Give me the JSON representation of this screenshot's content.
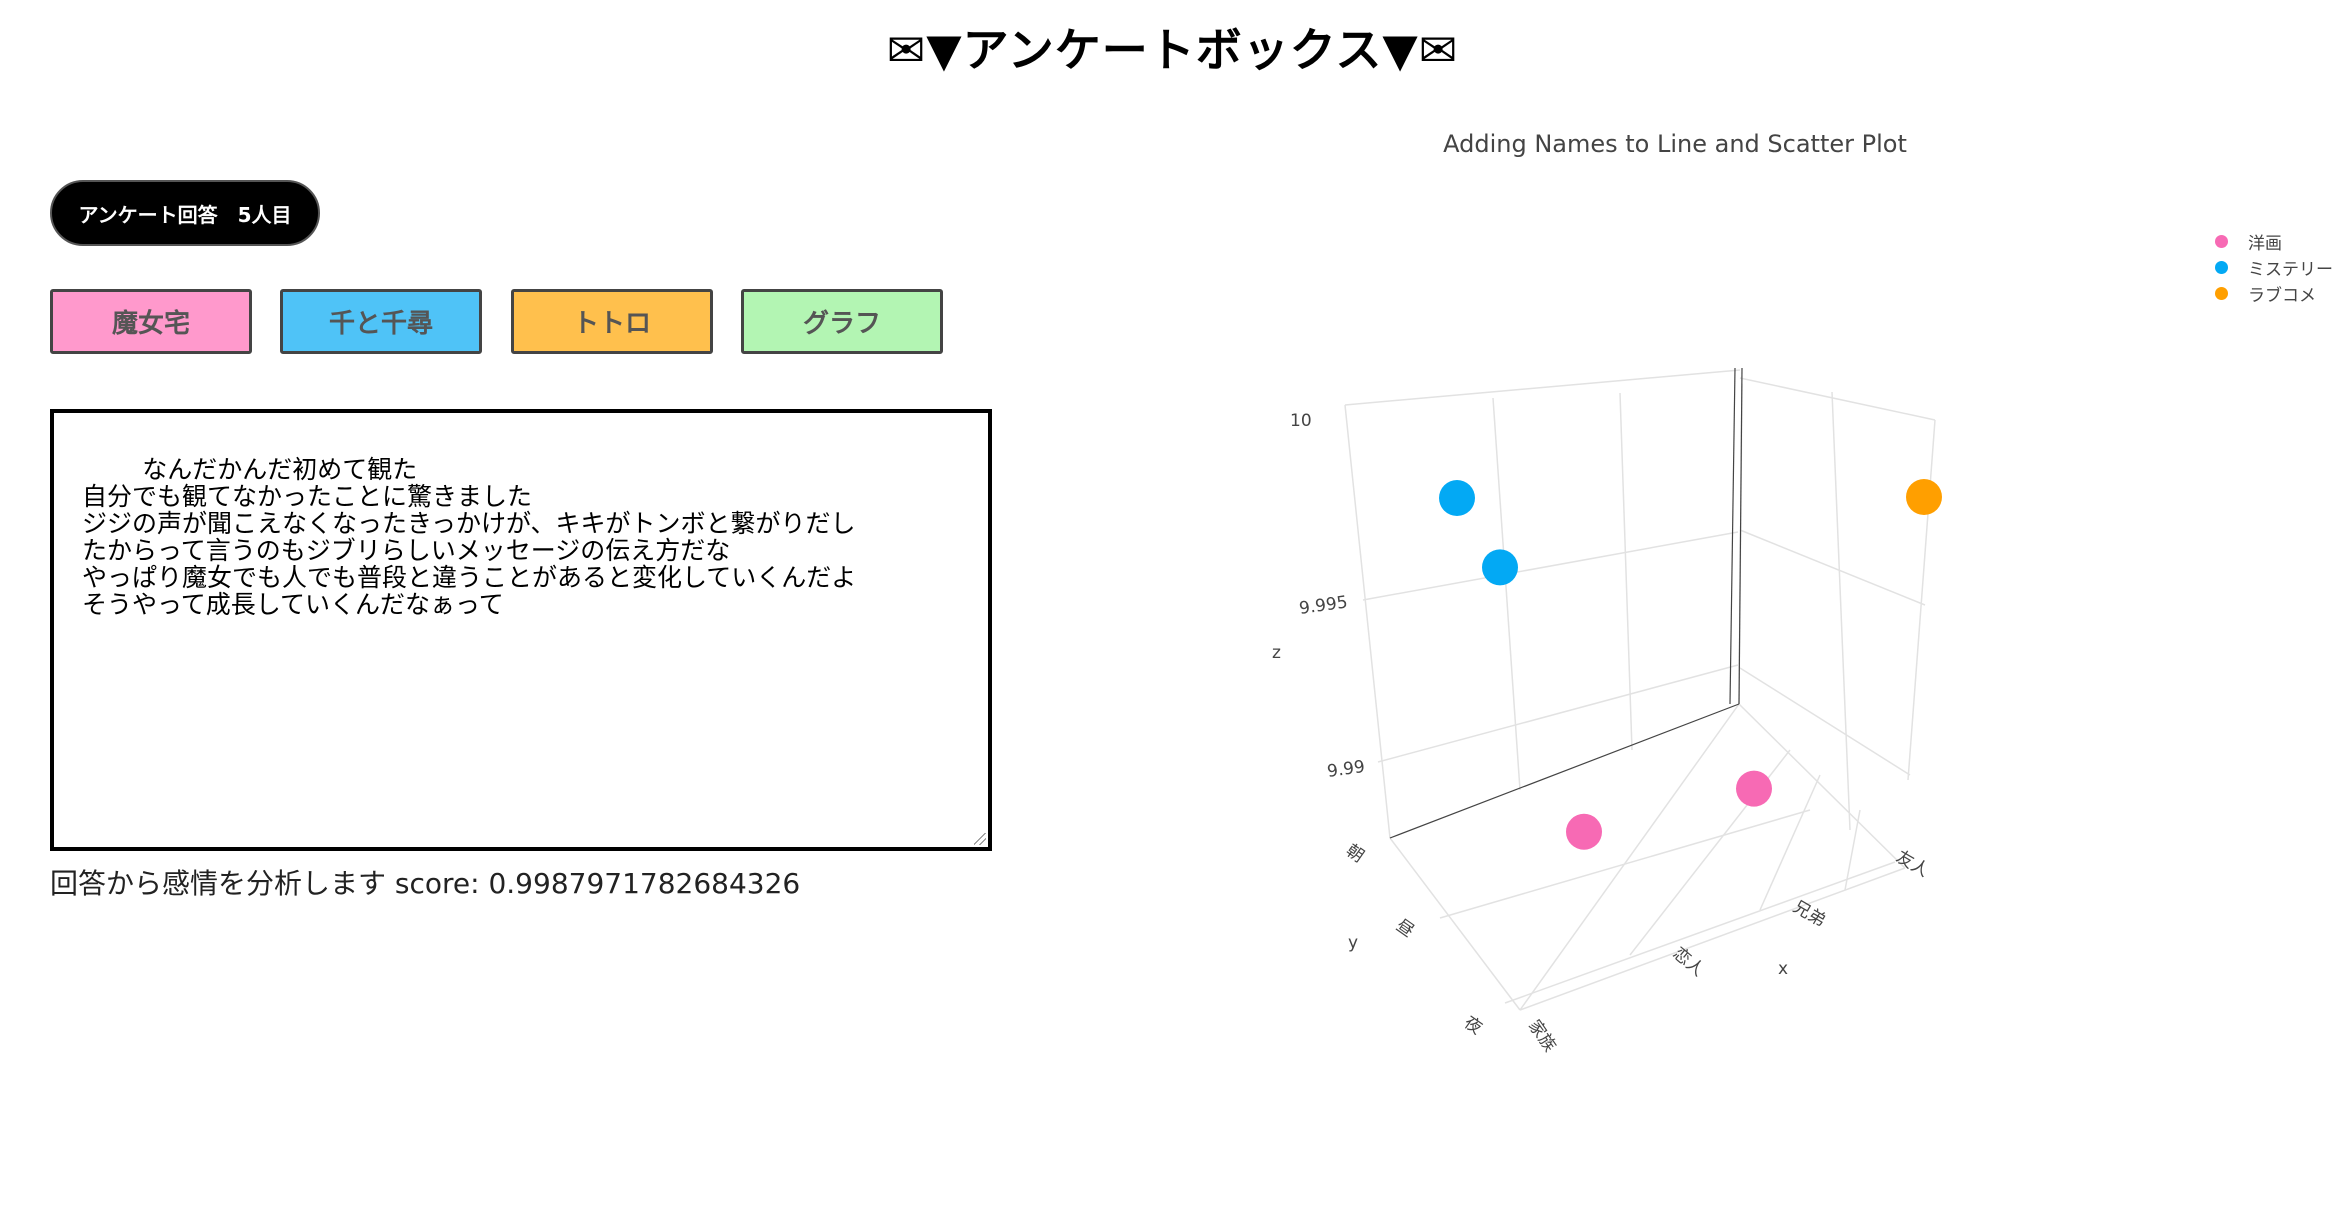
{
  "page": {
    "title": "✉▼アンケートボックス▼✉"
  },
  "respondent_badge": "アンケート回答　5人目",
  "buttons": [
    {
      "label": "魔女宅",
      "color": "#ff99cc"
    },
    {
      "label": "千と千尋",
      "color": "#4fc3f7"
    },
    {
      "label": "トトロ",
      "color": "#ffc04d"
    },
    {
      "label": "グラフ",
      "color": "#b3f5b3"
    }
  ],
  "answer_text": "なんだかんだ初めて観た\n自分でも観てなかったことに驚きました\nジジの声が聞こえなくなったきっかけが、キキがトンボと繋がりだし\nたからって言うのもジブリらしいメッセージの伝え方だな\nやっぱり魔女でも人でも普段と違うことがあると変化していくんだよ\nそうやって成長していくんだなぁって",
  "sentiment": "回答から感情を分析します score: 0.9987971782684326",
  "chart_data": {
    "type": "scatter",
    "title": "Adding Names to Line and Scatter Plot",
    "xlabel": "x",
    "ylabel": "y",
    "zlabel": "z",
    "x_categories": [
      "家族",
      "恋人",
      "兄弟",
      "友人"
    ],
    "y_categories": [
      "朝",
      "昼",
      "夜"
    ],
    "z_ticks": [
      "9.99",
      "9.995",
      "10"
    ],
    "legend_position": "top-right",
    "series": [
      {
        "name": "洋画",
        "color": "#f76ab4",
        "points": [
          {
            "x": "恋人",
            "y": "朝",
            "z": 9.9897
          },
          {
            "x": "兄弟",
            "y": "朝",
            "z": 9.9914
          }
        ]
      },
      {
        "name": "ミステリー",
        "color": "#03a9f4",
        "points": [
          {
            "x": "家族",
            "y": "夜",
            "z": 9.9996
          },
          {
            "x": "家族",
            "y": "昼",
            "z": 10.0
          }
        ]
      },
      {
        "name": "ラブコメ",
        "color": "#ff9f00",
        "points": [
          {
            "x": "友人",
            "y": "朝",
            "z": 10.0
          }
        ]
      }
    ]
  }
}
